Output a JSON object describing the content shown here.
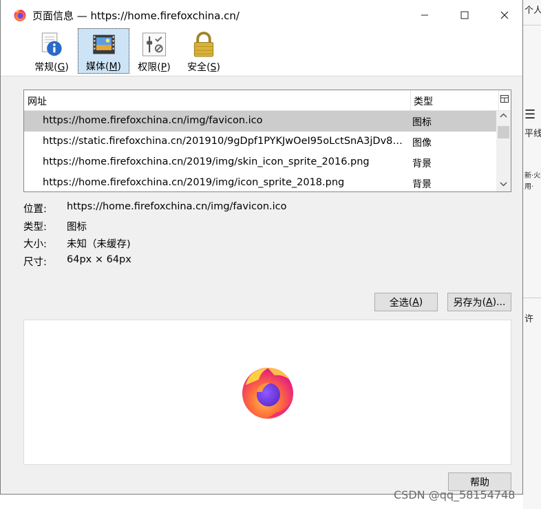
{
  "window": {
    "title": "页面信息 — https://home.firefoxchina.cn/",
    "app_icon": "firefox-icon"
  },
  "tabs": [
    {
      "label": "常规",
      "key": "G",
      "icon": "info-icon",
      "active": false
    },
    {
      "label": "媒体",
      "key": "M",
      "icon": "media-icon",
      "active": true
    },
    {
      "label": "权限",
      "key": "P",
      "icon": "permissions-icon",
      "active": false
    },
    {
      "label": "安全",
      "key": "S",
      "icon": "lock-icon",
      "active": false
    }
  ],
  "media_list": {
    "columns": {
      "url": "网址",
      "type": "类型"
    },
    "rows": [
      {
        "url": "https://home.firefoxchina.cn/img/favicon.ico",
        "type": "图标",
        "selected": true
      },
      {
        "url": "https://static.firefoxchina.cn/201910/9gDpf1PYKJwOeI95oLctSnA3jDv8B...",
        "type": "图像",
        "selected": false
      },
      {
        "url": "https://home.firefoxchina.cn/2019/img/skin_icon_sprite_2016.png",
        "type": "背景",
        "selected": false
      },
      {
        "url": "https://home.firefoxchina.cn/2019/img/icon_sprite_2018.png",
        "type": "背景",
        "selected": false
      }
    ]
  },
  "details": {
    "location_label": "位置:",
    "location": "https://home.firefoxchina.cn/img/favicon.ico",
    "type_label": "类型:",
    "type": "图标",
    "size_label": "大小:",
    "size": "未知（未缓存)",
    "dims_label": "尺寸:",
    "dims": "64px × 64px"
  },
  "buttons": {
    "select_all": "全选",
    "select_all_key": "A",
    "save_as": "另存为",
    "save_as_key": "A",
    "save_as_suffix": "...",
    "help": "帮助"
  },
  "background_page": {
    "frag1": "个人",
    "frag2": "平线",
    "frag3": "新·火狐",
    "frag4": "用·",
    "frag5": "许"
  },
  "watermark": "CSDN @qq_58154748",
  "colors": {
    "selection": "#cccccc",
    "active_tab": "#cde4f7",
    "dialog": "#f0f0f0"
  }
}
